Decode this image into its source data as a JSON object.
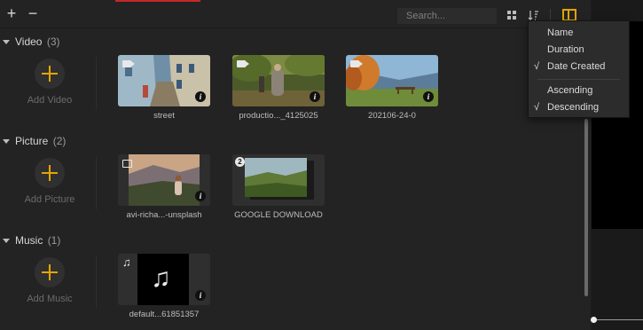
{
  "toolbar": {
    "add_label": "+",
    "remove_label": "−",
    "search_placeholder": "Search..."
  },
  "sections": {
    "video": {
      "title": "Video",
      "count": "(3)",
      "add_label": "Add Video",
      "items": [
        {
          "name": "street"
        },
        {
          "name": "productio..._4125025"
        },
        {
          "name": "202106-24-0"
        }
      ]
    },
    "picture": {
      "title": "Picture",
      "count": "(2)",
      "add_label": "Add Picture",
      "items": [
        {
          "name": "avi-richa...-unsplash"
        },
        {
          "name": "GOOGLE DOWNLOAD",
          "badge": "2"
        }
      ]
    },
    "music": {
      "title": "Music",
      "count": "(1)",
      "add_label": "Add Music",
      "items": [
        {
          "name": "default...61851357"
        }
      ]
    }
  },
  "sort_menu": {
    "items": [
      {
        "label": "Name",
        "checked": false
      },
      {
        "label": "Duration",
        "checked": false
      },
      {
        "label": "Date Created",
        "checked": true
      }
    ],
    "order": [
      {
        "label": "Ascending",
        "checked": false
      },
      {
        "label": "Descending",
        "checked": true
      }
    ],
    "check_mark": "√"
  },
  "icons": {
    "info": "i",
    "music_note": "♫",
    "big_music_note": "♫"
  },
  "colors": {
    "accent": "#e3a600",
    "tab_indicator": "#c62828",
    "background": "#232323"
  }
}
